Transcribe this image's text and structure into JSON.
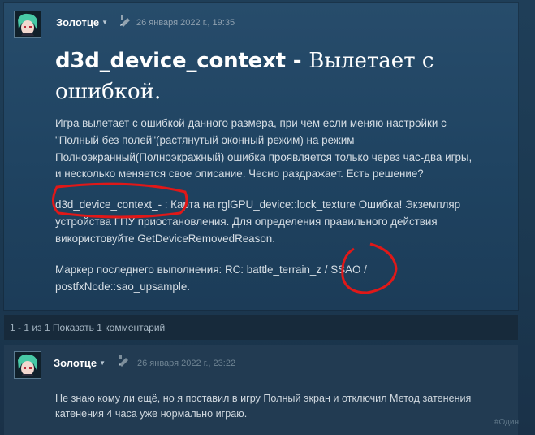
{
  "post": {
    "author": "Золотце",
    "date": "26 января 2022 г., 19:35",
    "title_code": "d3d_device_context - ",
    "title_text": "Вылетает с ошибкой.",
    "paragraph1": "Игра вылетает с ошибкой данного размера, при чем если меняю настройки с \"Полный без полей\"(растянутый оконный режим) на режим Полноэкранный(Полноэкражный) ошибка проявляется только через час-два игры, и несколько меняется свое описание. Чесно раздражает. Есть решение?",
    "paragraph2": "d3d_device_context_- : Карта на rglGPU_device::lock_texture Ошибка! Экземпляр устройства ГПУ приостановления. Для определения правильного действия використовуйте GetDeviceRemovedReason.",
    "paragraph3": "Маркер последнего выполнения: RC: battle_terrain_z / SSAO / postfxNode::sao_upsample."
  },
  "pager": {
    "range": "1 - 1 из 1",
    "show_comments": "Показать 1 комментарий"
  },
  "comment": {
    "author": "Золотце",
    "date": "26 января 2022 г., 23:22",
    "text": "Не знаю кому ли ещё, но я поставил в игру Полный экран и отключил Метод затенения катенения 4 часа уже нормально играю.",
    "tag": "#Один"
  },
  "icons": {
    "caret": "caret-down-icon",
    "edit": "pencil-edit-icon"
  },
  "colors": {
    "annotation": "#e01818",
    "panel": "#244a69"
  }
}
